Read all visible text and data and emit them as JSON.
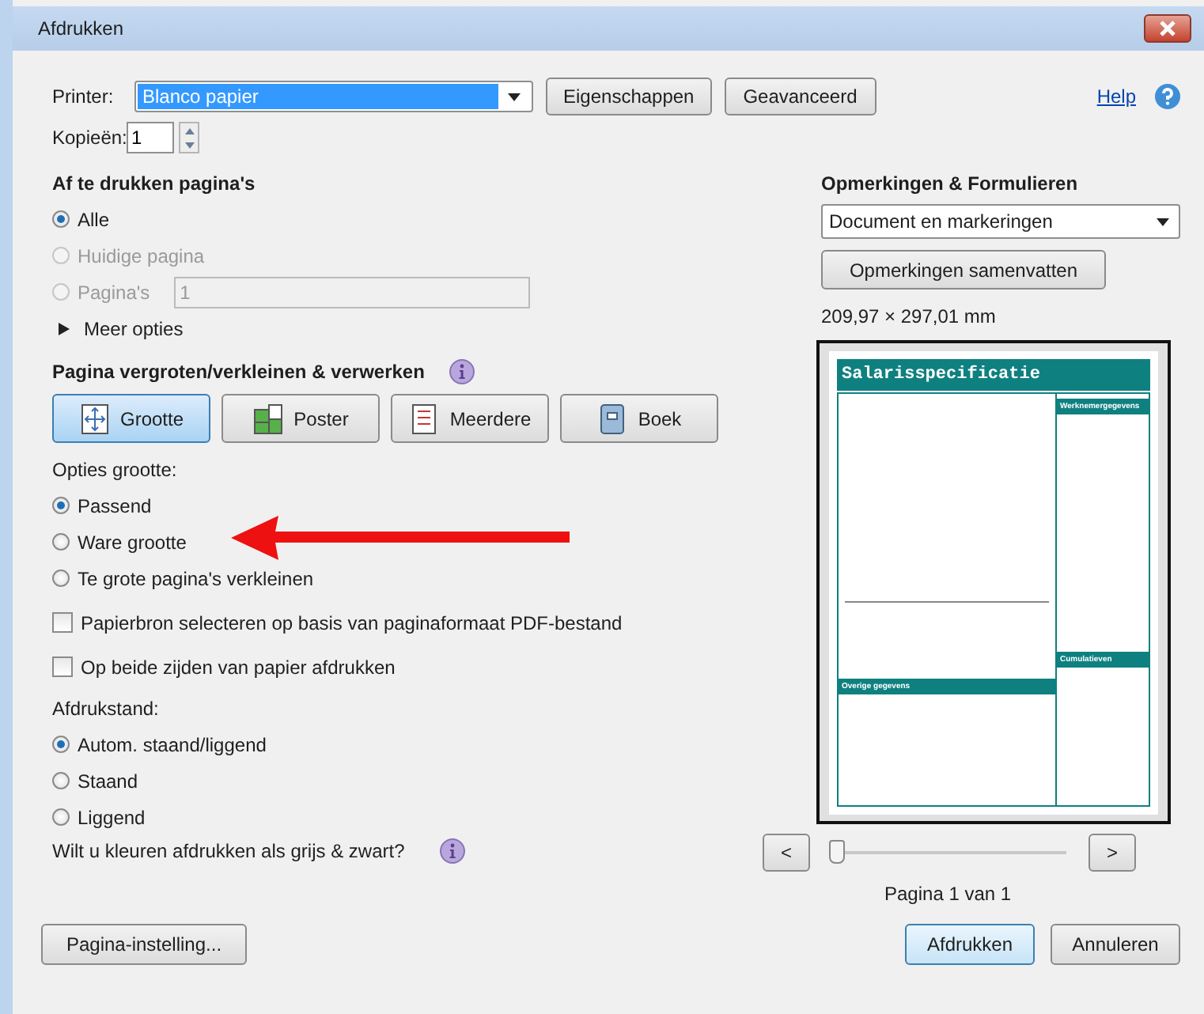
{
  "window": {
    "title": "Afdrukken"
  },
  "printer": {
    "label": "Printer:",
    "value": "Blanco papier"
  },
  "top_buttons": [
    "Eigenschappen",
    "Geavanceerd"
  ],
  "help": "Help",
  "copies": {
    "label": "Kopieën:",
    "value": "1"
  },
  "pages": {
    "title": "Af te drukken pagina's",
    "options": [
      {
        "label": "Alle",
        "selected": true,
        "disabled": false
      },
      {
        "label": "Huidige pagina",
        "selected": false,
        "disabled": true
      },
      {
        "label": "Pagina's",
        "selected": false,
        "disabled": true,
        "field": "1"
      }
    ],
    "more": "Meer opties"
  },
  "scaling": {
    "title": "Pagina vergroten/verkleinen & verwerken",
    "modes": [
      {
        "label": "Grootte",
        "selected": true
      },
      {
        "label": "Poster",
        "selected": false
      },
      {
        "label": "Meerdere",
        "selected": false
      },
      {
        "label": "Boek",
        "selected": false
      }
    ],
    "options_label": "Opties grootte:",
    "options": [
      {
        "label": "Passend",
        "selected": true
      },
      {
        "label": "Ware grootte",
        "selected": false
      },
      {
        "label": "Te grote pagina's verkleinen",
        "selected": false
      }
    ],
    "checkboxes": [
      {
        "label": "Papierbron selecteren op basis van paginaformaat PDF-bestand",
        "checked": false
      },
      {
        "label": "Op beide zijden van papier afdrukken",
        "checked": false
      }
    ]
  },
  "orientation": {
    "label": "Afdrukstand:",
    "options": [
      {
        "label": "Autom. staand/liggend",
        "selected": true
      },
      {
        "label": "Staand",
        "selected": false
      },
      {
        "label": "Liggend",
        "selected": false
      }
    ]
  },
  "grayscale": "Wilt u kleuren afdrukken als grijs & zwart?",
  "page_setup": "Pagina-instelling...",
  "comments": {
    "title": "Opmerkingen & Formulieren",
    "dropdown": "Document en markeringen",
    "summarize": "Opmerkingen samenvatten",
    "size": "209,97 × 297,01 mm"
  },
  "preview": {
    "title": "Salarisspecificatie",
    "sections": [
      "Werknemergegevens",
      "Cumulatieven",
      "Overige gegevens"
    ]
  },
  "pager": {
    "prev": "<",
    "next": ">",
    "level": 0,
    "label": "Pagina 1 van 1"
  },
  "actions": [
    {
      "label": "Afdrukken",
      "default": true
    },
    {
      "label": "Annuleren",
      "default": false
    }
  ]
}
